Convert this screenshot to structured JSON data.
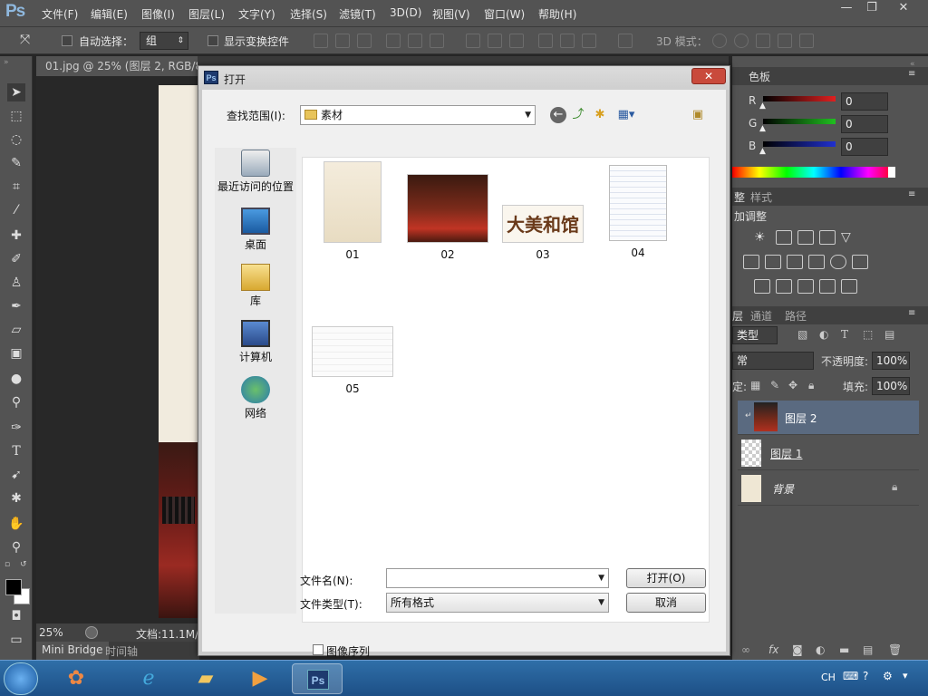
{
  "app": {
    "logo": "Ps"
  },
  "menu": [
    "文件(F)",
    "编辑(E)",
    "图像(I)",
    "图层(L)",
    "文字(Y)",
    "选择(S)",
    "滤镜(T)",
    "3D(D)",
    "视图(V)",
    "窗口(W)",
    "帮助(H)"
  ],
  "window_controls": {
    "minimize": "—",
    "restore": "❐",
    "close": "✕"
  },
  "options": {
    "auto_select_label": "自动选择：",
    "auto_select_value": "组",
    "show_transform_label": "显示变换控件",
    "mode_3d_label": "3D 模式："
  },
  "document_tab": {
    "title": "01.jpg @ 25% (图层 2, RGB/8)",
    "close": "×"
  },
  "status": {
    "zoom": "25%",
    "doc_size": "文档:11.1M/"
  },
  "bottom_tabs": [
    "Mini Bridge",
    "时间轴"
  ],
  "color_panel": {
    "tab": "色板",
    "channels": [
      {
        "name": "R",
        "value": "0",
        "color": "#e02020"
      },
      {
        "name": "G",
        "value": "0",
        "color": "#20c020"
      },
      {
        "name": "B",
        "value": "0",
        "color": "#2030d0"
      }
    ]
  },
  "adjust_panel": {
    "tabs": [
      "整",
      "样式"
    ],
    "title": "加调整"
  },
  "layers_panel": {
    "tabs": [
      "层",
      "通道",
      "路径"
    ],
    "kind_value": "类型",
    "blend_value": "常",
    "opacity_label": "不透明度:",
    "opacity_value": "100%",
    "lock_label": "定:",
    "fill_label": "填充:",
    "fill_value": "100%",
    "layers": [
      {
        "name": "图层 2",
        "selected": true
      },
      {
        "name": "图层 1",
        "selected": false
      },
      {
        "name": "背景",
        "selected": false
      }
    ]
  },
  "dialog": {
    "title": "打开",
    "close": "✕",
    "look_in_label": "查找范围(I):",
    "look_in_value": "素材",
    "places": [
      "最近访问的位置",
      "桌面",
      "库",
      "计算机",
      "网络"
    ],
    "files": [
      "01",
      "02",
      "03",
      "04",
      "05"
    ],
    "file_name_label": "文件名(N):",
    "file_name_value": "",
    "file_type_label": "文件类型(T):",
    "file_type_value": "所有格式",
    "open_button": "打开(O)",
    "cancel_button": "取消",
    "sequence_label": "图像序列",
    "thumb_03_text": "大美和馆"
  },
  "taskbar": {
    "lang": "CH"
  }
}
